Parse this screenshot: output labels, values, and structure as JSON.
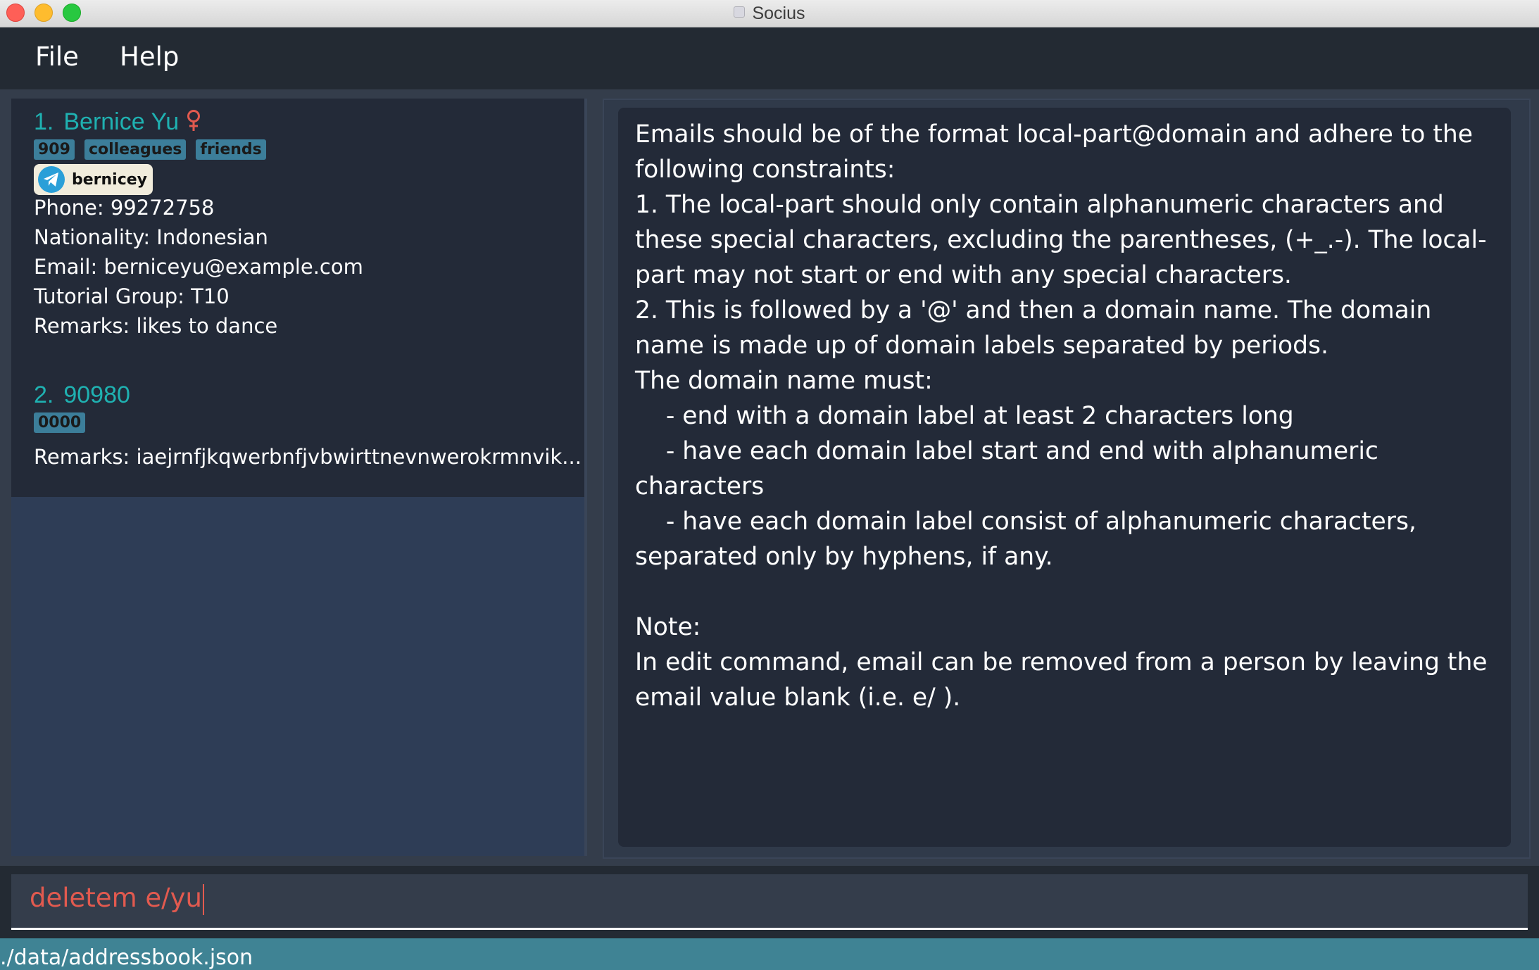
{
  "window": {
    "title": "Socius",
    "controls": [
      "close-button",
      "minimize-button",
      "zoom-button"
    ]
  },
  "menu": {
    "items": [
      "File",
      "Help"
    ]
  },
  "person_list": [
    {
      "index": "1.",
      "name": "Bernice Yu",
      "gender_icon": "female-icon",
      "tags": [
        "909",
        "colleagues",
        "friends"
      ],
      "telegram": "bernicey",
      "fields": [
        "Phone: 99272758",
        "Nationality: Indonesian",
        "Email: berniceyu@example.com",
        "Tutorial Group: T10",
        "Remarks: likes to dance"
      ]
    },
    {
      "index": "2.",
      "name": "90980",
      "tags": [
        "0000"
      ],
      "fields": [
        "Remarks: iaejrnfjkqwerbnfjvbwirttnevnwerokrmnvik..."
      ]
    }
  ],
  "result_display": {
    "text": "Emails should be of the format local-part@domain and adhere to the following constraints:\n1. The local-part should only contain alphanumeric characters and these special characters, excluding the parentheses, (+_.-). The local-part may not start or end with any special characters.\n2. This is followed by a '@' and then a domain name. The domain name is made up of domain labels separated by periods.\nThe domain name must:\n    - end with a domain label at least 2 characters long\n    - have each domain label start and end with alphanumeric characters\n    - have each domain label consist of alphanumeric characters, separated only by hyphens, if any.\n\nNote:\nIn edit command, email can be removed from a person by leaving the email value blank (i.e. e/ )."
  },
  "command_box": {
    "value": "deletem e/yu"
  },
  "status_bar": {
    "path": "./data/addressbook.json"
  },
  "colors": {
    "name_accent": "#1fb1b1",
    "tag_bg": "#3c7e9a",
    "command_error": "#e25a4f",
    "status_bar": "#3f8394"
  }
}
